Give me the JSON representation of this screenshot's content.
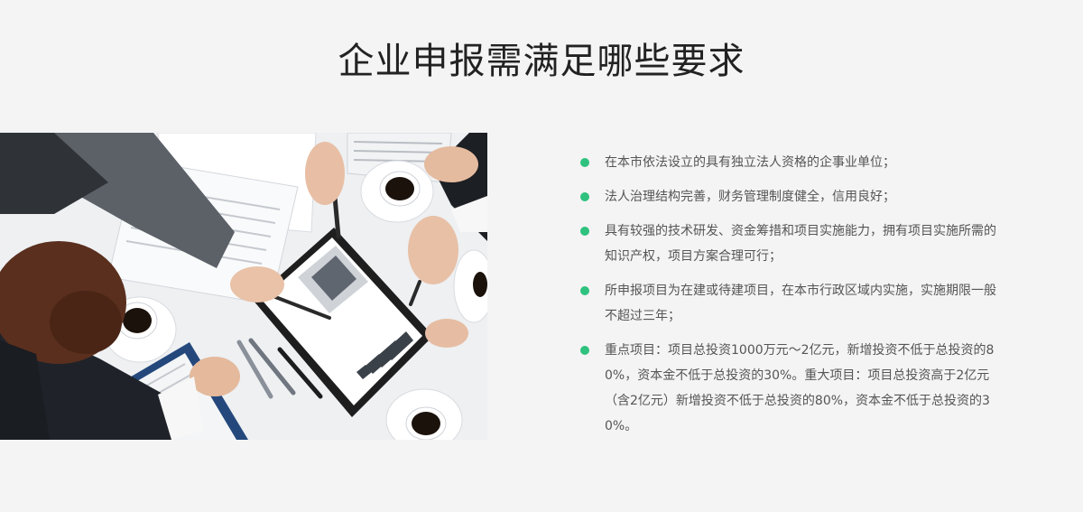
{
  "page": {
    "title": "企业申报需满足哪些要求"
  },
  "photo": {
    "icon": "business-meeting-photo"
  },
  "requirements": [
    {
      "text": "在本市依法设立的具有独立法人资格的企事业单位；"
    },
    {
      "text": "法人治理结构完善，财务管理制度健全，信用良好；"
    },
    {
      "text": "具有较强的技术研发、资金筹措和项目实施能力，拥有项目实施所需的知识产权，项目方案合理可行；"
    },
    {
      "text": "所申报项目为在建或待建项目，在本市行政区域内实施，实施期限一般不超过三年；"
    },
    {
      "text": "重点项目：项目总投资1000万元～2亿元，新增投资不低于总投资的80%，资本金不低于总投资的30%。重大项目：项目总投资高于2亿元（含2亿元）新增投资不低于总投资的80%，资本金不低于总投资的30%。"
    }
  ],
  "colors": {
    "bullet": "#2ec27e",
    "background": "#f4f4f4"
  }
}
